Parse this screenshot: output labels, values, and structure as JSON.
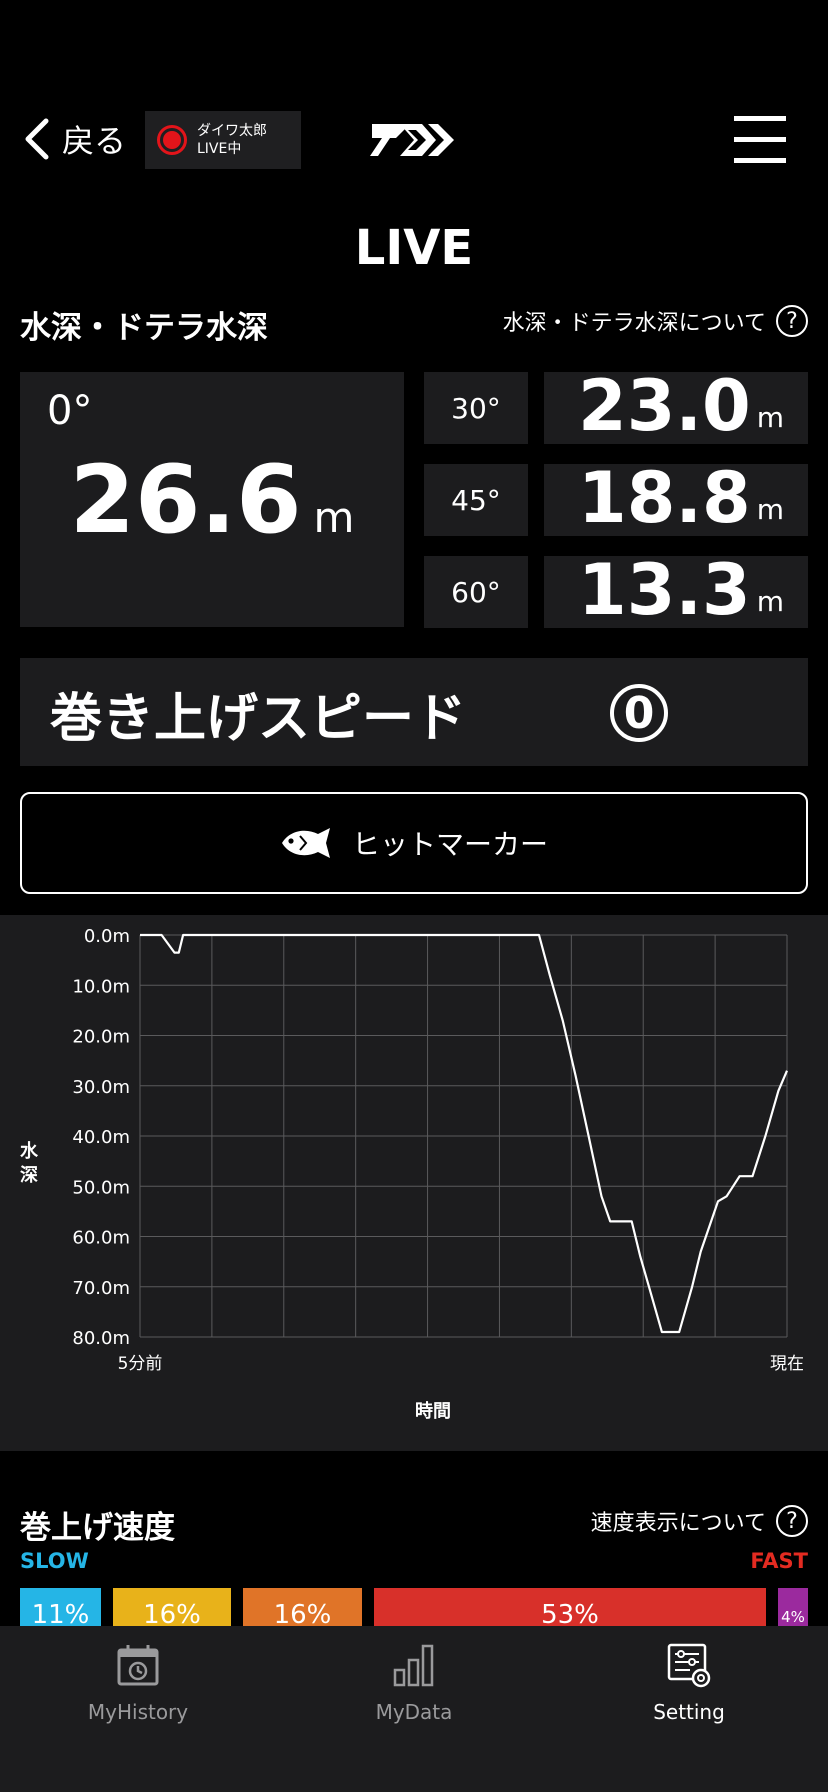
{
  "header": {
    "back_label": "戻る",
    "user_name": "ダイワ太郎",
    "live_status": "LIVE中"
  },
  "page_title": "LIVE",
  "depth_section": {
    "heading": "水深・ドテラ水深",
    "help_label": "水深・ドテラ水深について",
    "help_icon": "?",
    "main": {
      "angle": "0°",
      "value": "26.6",
      "unit": "m"
    },
    "angles": [
      {
        "angle": "30°",
        "value": "23.0",
        "unit": "m"
      },
      {
        "angle": "45°",
        "value": "18.8",
        "unit": "m"
      },
      {
        "angle": "60°",
        "value": "13.3",
        "unit": "m"
      }
    ]
  },
  "speed_panel": {
    "label": "巻き上げスピード",
    "level": "0"
  },
  "hit_marker": {
    "label": "ヒットマーカー"
  },
  "chart_data": {
    "type": "line",
    "ylabel": "水深",
    "xlabel": "時間",
    "x_tick_labels": [
      "5分前",
      "現在"
    ],
    "y_tick_labels": [
      "0.0m",
      "10.0m",
      "20.0m",
      "30.0m",
      "40.0m",
      "50.0m",
      "60.0m",
      "70.0m",
      "80.0m"
    ],
    "ylim": [
      0,
      80
    ],
    "xlim": [
      0,
      300
    ],
    "y_inverted": true,
    "grid": true,
    "series": [
      {
        "x": [
          0,
          10,
          16,
          18,
          20,
          300
        ],
        "y": [
          0,
          0,
          3.5,
          3.5,
          0,
          0
        ]
      }
    ],
    "points": [
      [
        0,
        0
      ],
      [
        10,
        0
      ],
      [
        16,
        3.5
      ],
      [
        18,
        3.5
      ],
      [
        20,
        0
      ],
      [
        185,
        0
      ],
      [
        190,
        8
      ],
      [
        196,
        17
      ],
      [
        202,
        28
      ],
      [
        208,
        40
      ],
      [
        214,
        52
      ],
      [
        218,
        57
      ],
      [
        228,
        57
      ],
      [
        232,
        64
      ],
      [
        236,
        70
      ],
      [
        242,
        79
      ],
      [
        250,
        79
      ],
      [
        256,
        70
      ],
      [
        260,
        63
      ],
      [
        264,
        58
      ],
      [
        268,
        53
      ],
      [
        272,
        52
      ],
      [
        278,
        48
      ],
      [
        284,
        48
      ],
      [
        290,
        40
      ],
      [
        296,
        31
      ],
      [
        300,
        27
      ]
    ],
    "line_color": "#ffffff"
  },
  "retrieve_speed": {
    "heading": "巻上げ速度",
    "help_label": "速度表示について",
    "help_icon": "?",
    "slow_label": "SLOW",
    "fast_label": "FAST",
    "segments": [
      {
        "label": "11%",
        "color": "#25b5e6"
      },
      {
        "label": "16%",
        "color": "#e8b21a"
      },
      {
        "label": "16%",
        "color": "#e07428"
      },
      {
        "label": "53%",
        "color": "#d8302a"
      },
      {
        "label": "4%",
        "color": "#9b2a9e"
      }
    ]
  },
  "bottom_nav": {
    "items": [
      {
        "label": "MyHistory",
        "icon": "calendar-history-icon"
      },
      {
        "label": "MyData",
        "icon": "bar-chart-icon"
      },
      {
        "label": "Setting",
        "icon": "settings-sliders-icon",
        "active": true
      }
    ]
  }
}
